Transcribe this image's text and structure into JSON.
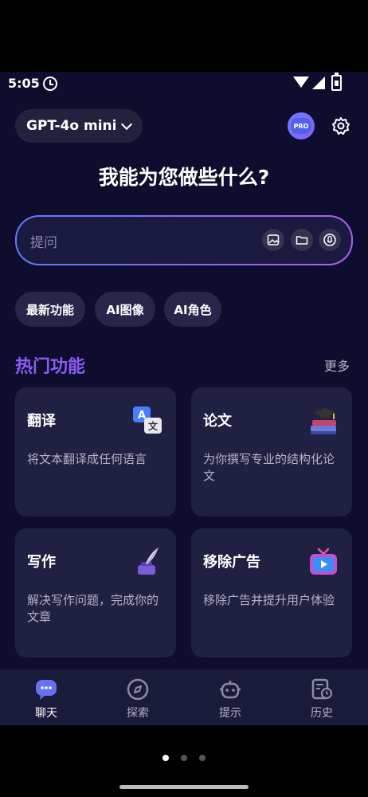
{
  "status": {
    "time": "5:05"
  },
  "header": {
    "model": "GPT-4o mini",
    "pro_label": "PRO"
  },
  "headline": "我能为您做些什么?",
  "search": {
    "placeholder": "提问"
  },
  "chips": [
    "最新功能",
    "AI图像",
    "AI角色"
  ],
  "section": {
    "title": "热门功能",
    "more": "更多"
  },
  "cards": [
    {
      "title": "翻译",
      "desc": "将文本翻译成任何语言",
      "icon": "translate-icon"
    },
    {
      "title": "论文",
      "desc": "为你撰写专业的结构化论文",
      "icon": "books-icon"
    },
    {
      "title": "写作",
      "desc": "解决写作问题，完成你的文章",
      "icon": "quill-icon"
    },
    {
      "title": "移除广告",
      "desc": "移除广告并提升用户体验",
      "icon": "tv-icon"
    }
  ],
  "nav": [
    {
      "label": "聊天",
      "icon": "chat-icon",
      "active": true
    },
    {
      "label": "探索",
      "icon": "compass-icon",
      "active": false
    },
    {
      "label": "提示",
      "icon": "robot-icon",
      "active": false
    },
    {
      "label": "历史",
      "icon": "history-icon",
      "active": false
    }
  ],
  "colors": {
    "background": "#0e0d2e",
    "accent": "#8b5cf6",
    "card": "#202043"
  }
}
